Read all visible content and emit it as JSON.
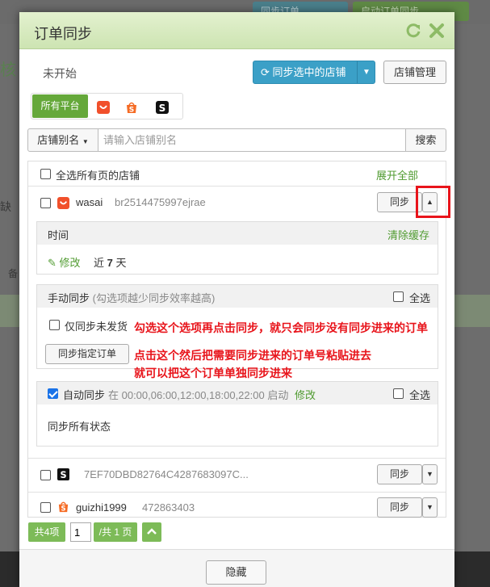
{
  "background": {
    "top_buttons": [
      "同步订单",
      "启动订单同步"
    ],
    "left_chars": [
      "核",
      "缺",
      "备"
    ]
  },
  "modal": {
    "title": "订单同步",
    "refresh_icon": "refresh-icon",
    "close_icon": "close-icon",
    "status": "未开始",
    "sync_selected_label": "同步选中的店铺",
    "store_mgmt_label": "店铺管理",
    "platforms": {
      "all_label": "所有平台",
      "icons": [
        {
          "name": "taobao-icon",
          "color": "#f1502b",
          "glyph": "◡"
        },
        {
          "name": "shopee-icon",
          "color": "#f56b24",
          "glyph": "S"
        },
        {
          "name": "shein-icon",
          "color": "#111111",
          "glyph": "S"
        }
      ]
    },
    "search": {
      "alias_select": "店铺别名",
      "placeholder": "请输入店铺别名",
      "button": "搜索"
    },
    "list": {
      "select_all_label": "全选所有页的店铺",
      "expand_all": "展开全部",
      "stores": [
        {
          "name": "wasai",
          "id": "br2514475997ejrae",
          "platform": "taobao",
          "sync_label": "同步",
          "expanded": true
        },
        {
          "name": "",
          "id": "7EF70DBD82764C4287683097C...",
          "platform": "shein",
          "sync_label": "同步",
          "expanded": false
        },
        {
          "name": "guizhi1999",
          "id": "472863403",
          "platform": "shopee",
          "sync_label": "同步",
          "expanded": false
        }
      ]
    },
    "expanded": {
      "time_label": "时间",
      "clear_cache": "清除缓存",
      "edit_label": "修改",
      "recent_prefix": "近",
      "recent_days": "7",
      "recent_suffix": "天",
      "manual_title": "手动同步",
      "manual_hint": "(勾选项越少同步效率越高)",
      "select_all": "全选",
      "only_unshipped": "仅同步未发货",
      "sync_specific": "同步指定订单",
      "auto_sync": "自动同步",
      "auto_schedule": "在 00:00,06:00,12:00,18:00,22:00 启动",
      "auto_edit": "修改",
      "auto_checked": true,
      "sync_all_status": "同步所有状态"
    },
    "annotations": [
      "勾选这个选项再点击同步，就只会同步没有同步进来的订单",
      "点击这个然后把需要同步进来的订单号粘贴进去",
      "就可以把这个订单单独同步进来"
    ],
    "pager": {
      "total": "共4项",
      "page": "1",
      "of_pages": "/共 1 页"
    },
    "footer": {
      "hide_label": "隐藏"
    }
  }
}
